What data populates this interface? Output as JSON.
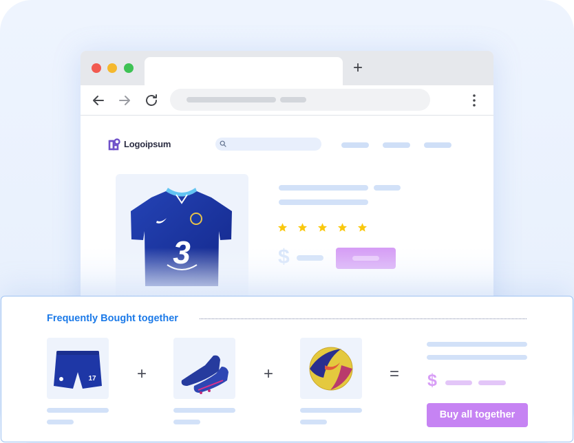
{
  "browser": {
    "new_tab_symbol": "+",
    "colors": {
      "close": "#f25a50",
      "minimize": "#f5b82e",
      "maximize": "#3ec255"
    }
  },
  "site": {
    "logo_text": "Logoipsum",
    "rating_stars": 5,
    "star_color": "#f9c80e",
    "currency_symbol": "$"
  },
  "bundle": {
    "title": "Frequently Bought together",
    "operators": [
      "+",
      "+",
      "="
    ],
    "items": [
      {
        "name": "shorts-image"
      },
      {
        "name": "boots-image"
      },
      {
        "name": "ball-image"
      }
    ],
    "currency_symbol": "$",
    "buy_label": "Buy all together",
    "accent_color": "#c683f3",
    "title_color": "#1c7ae8"
  }
}
